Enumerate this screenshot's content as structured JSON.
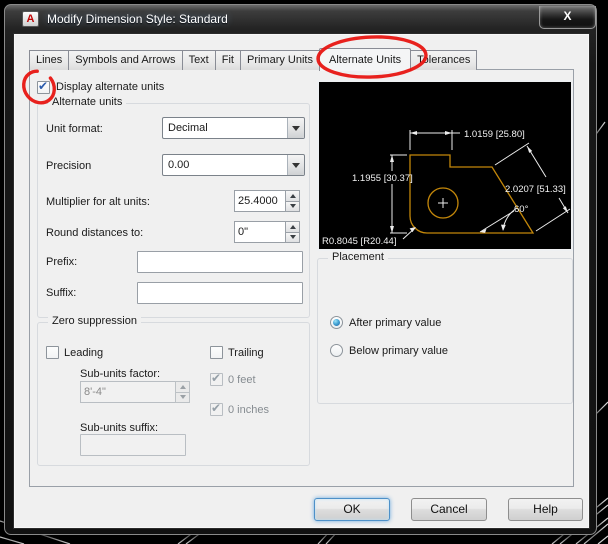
{
  "window": {
    "title": "Modify Dimension Style: Standard",
    "app_icon_letter": "A",
    "close": "X"
  },
  "tabs": {
    "items": [
      {
        "label": "Lines"
      },
      {
        "label": "Symbols and Arrows"
      },
      {
        "label": "Text"
      },
      {
        "label": "Fit"
      },
      {
        "label": "Primary Units"
      },
      {
        "label": "Alternate Units"
      },
      {
        "label": "Tolerances"
      }
    ],
    "active": "Alternate Units"
  },
  "main": {
    "display_checkbox": {
      "label": "Display alternate units",
      "checked": true
    },
    "alternate_units": {
      "title": "Alternate units",
      "unit_format": {
        "label": "Unit format:",
        "value": "Decimal"
      },
      "precision": {
        "label": "Precision",
        "value": "0.00"
      },
      "multiplier": {
        "label": "Multiplier for alt units:",
        "value": "25.4000"
      },
      "round": {
        "label": "Round distances to:",
        "value": "0\""
      },
      "prefix": {
        "label": "Prefix:",
        "value": ""
      },
      "suffix": {
        "label": "Suffix:",
        "value": ""
      }
    },
    "zero_suppression": {
      "title": "Zero suppression",
      "leading": {
        "label": "Leading",
        "checked": false
      },
      "trailing": {
        "label": "Trailing",
        "checked": false
      },
      "subunits_factor": {
        "label": "Sub-units factor:",
        "value": "8'-4\"",
        "disabled": true
      },
      "zero_feet": {
        "label": "0 feet",
        "checked": true,
        "disabled": true
      },
      "zero_inches": {
        "label": "0 inches",
        "checked": true,
        "disabled": true
      },
      "subunits_suffix": {
        "label": "Sub-units suffix:",
        "value": "",
        "disabled": true
      }
    },
    "placement": {
      "title": "Placement",
      "options": [
        {
          "label": "After primary value",
          "selected": true
        },
        {
          "label": "Below primary value",
          "selected": false
        }
      ]
    },
    "preview": {
      "dim_horizontal": "1.0159 [25.80]",
      "dim_vertical": "1.1955 [30.37]",
      "dim_aligned": "2.0207 [51.33]",
      "dim_angle": "60°",
      "dim_radius": "R0.8045 [R20.44]"
    }
  },
  "footer": {
    "ok": "OK",
    "cancel": "Cancel",
    "help": "Help"
  },
  "icons": {
    "check": "✔"
  },
  "colors": {
    "annotation_red": "#e8120e",
    "preview_line_orange": "#c3870a",
    "preview_dim_white": "#ececec",
    "preview_bg": "#000000",
    "dialog_bg": "#f0f0f0"
  }
}
